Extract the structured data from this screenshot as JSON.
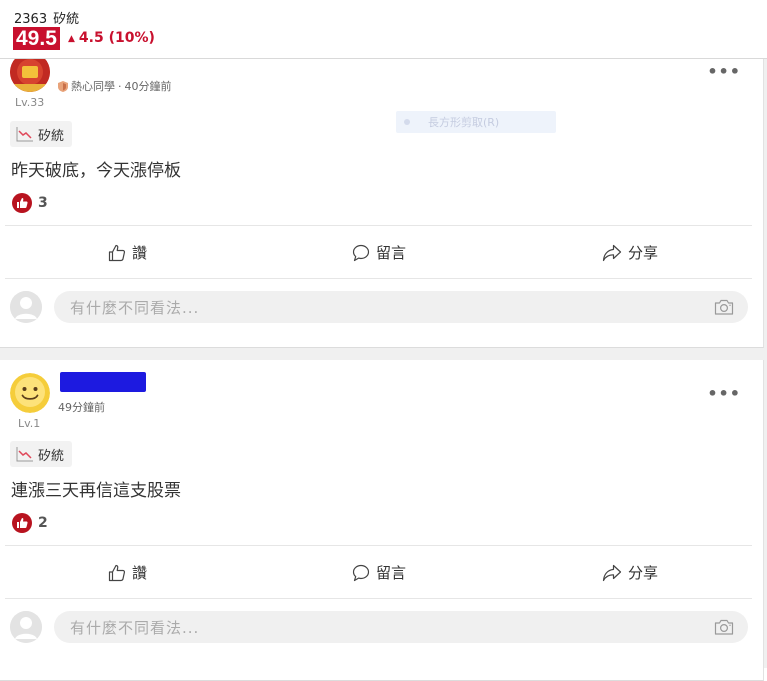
{
  "stock": {
    "code": "2363",
    "name": "矽統",
    "price": "49.5",
    "change": "4.5 (10%)"
  },
  "posts": [
    {
      "level": "Lv.33",
      "badge": "熱心同學",
      "time": "40分鐘前",
      "tag": "矽統",
      "text": "昨天破底，今天漲停板",
      "likes": "3",
      "actions": {
        "like": "讚",
        "comment": "留言",
        "share": "分享"
      },
      "comment_placeholder": "有什麼不同看法..."
    },
    {
      "level": "Lv.1",
      "time": "49分鐘前",
      "tag": "矽統",
      "text": "連漲三天再信這支股票",
      "likes": "2",
      "actions": {
        "like": "讚",
        "comment": "留言",
        "share": "分享"
      },
      "comment_placeholder": "有什麼不同看法..."
    }
  ],
  "overlay_hint": "長方形剪取(R)",
  "colors": {
    "accent_red": "#c8102e",
    "like_red": "#b8131f",
    "redaction_blue": "#1d1ae0"
  },
  "icons": [
    "more-icon",
    "trend-chart-icon",
    "thumbs-up-icon",
    "comment-icon",
    "share-icon",
    "camera-icon",
    "default-avatar-icon",
    "smiley-avatar-icon"
  ]
}
